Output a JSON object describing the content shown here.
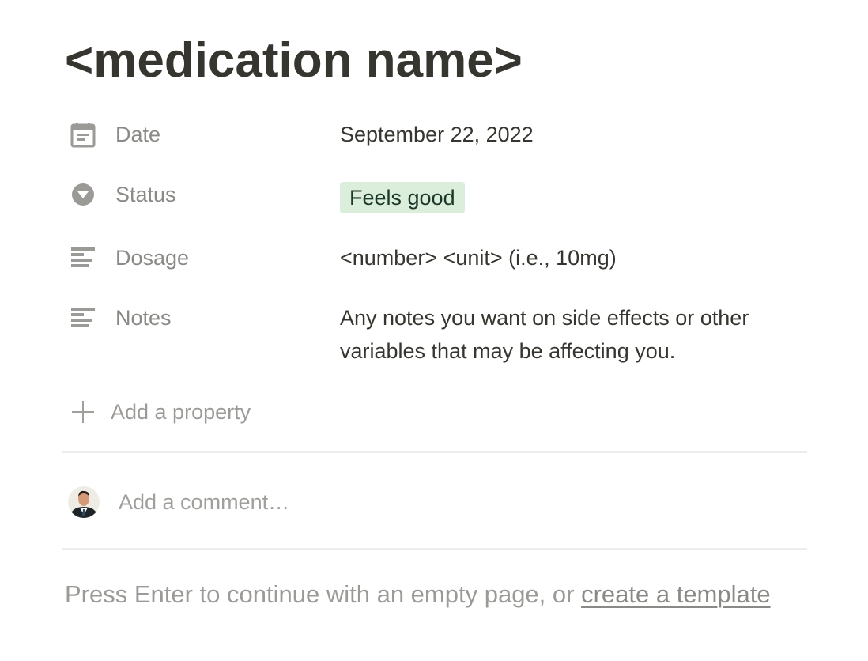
{
  "page": {
    "title": "<medication name>"
  },
  "properties": [
    {
      "icon": "calendar-icon",
      "label": "Date",
      "value": "September 22, 2022"
    },
    {
      "icon": "select-icon",
      "label": "Status",
      "value": "Feels good",
      "tag_color": "#dbeddb"
    },
    {
      "icon": "text-lines-icon",
      "label": "Dosage",
      "value": "<number> <unit> (i.e., 10mg)"
    },
    {
      "icon": "text-lines-icon",
      "label": "Notes",
      "value": "Any notes you want on side effects or other variables that may be affecting you."
    }
  ],
  "add_property": {
    "icon": "plus-icon",
    "label": "Add a property"
  },
  "comment": {
    "avatar": "avatar",
    "placeholder": "Add a comment…"
  },
  "footer": {
    "text": "Press Enter to continue with an empty page, or ",
    "link": "create a template"
  },
  "colors": {
    "text": "#37352f",
    "muted": "#9b9a97",
    "status_tag_bg": "#dbeddb",
    "divider": "#ededec"
  }
}
